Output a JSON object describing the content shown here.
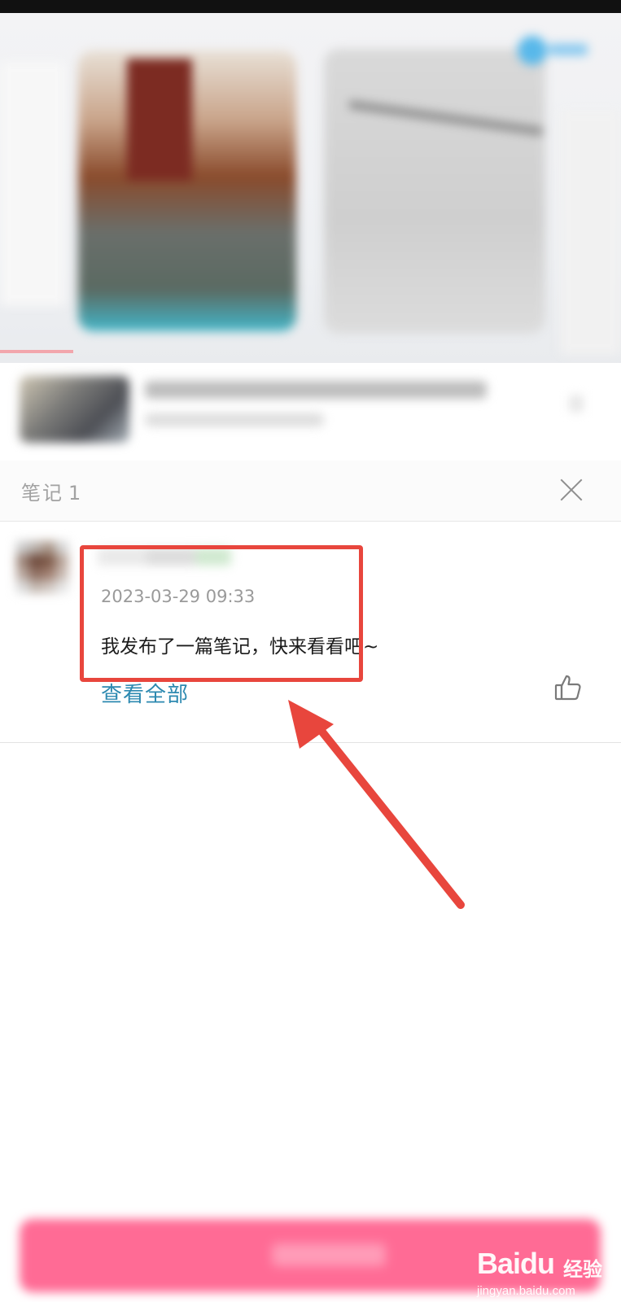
{
  "notes_panel": {
    "title": "笔记",
    "count": "1"
  },
  "note": {
    "timestamp": "2023-03-29 09:33",
    "text": "我发布了一篇笔记，快来看看吧~",
    "view_all_label": "查看全部"
  },
  "annotation": {
    "highlight_color": "#e8463d"
  },
  "colors": {
    "link": "#2c89b0",
    "publish_button": "#ff6b95"
  },
  "watermark": {
    "brand": "Baidu",
    "brand_cn": "经验",
    "url": "jingyan.baidu.com"
  }
}
